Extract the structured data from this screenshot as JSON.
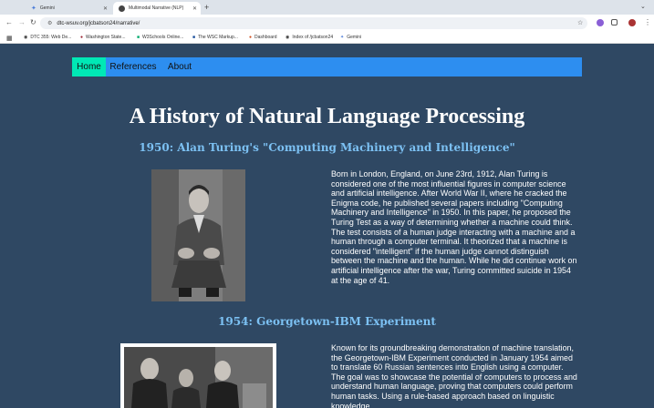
{
  "browser": {
    "tabs": [
      {
        "title": "Gemini"
      },
      {
        "title": "Multimodal Narrative (NLP)"
      }
    ],
    "new_tab": "+",
    "tab_menu": "⌄",
    "url": "dtc-wsuv.org/jcbatson24/narrative/",
    "bookmarks": [
      {
        "label": "DTC 355: Web De..."
      },
      {
        "label": "Washington State..."
      },
      {
        "label": "W3Schools Online..."
      },
      {
        "label": "The WSC Markup..."
      },
      {
        "label": "Dashboard"
      },
      {
        "label": "Index of /jcbatson24"
      },
      {
        "label": "Gemini"
      }
    ]
  },
  "nav": {
    "home": "Home",
    "references": "References",
    "about": "About"
  },
  "page": {
    "title": "A History of Natural Language Processing",
    "sections": [
      {
        "heading": "1950: Alan Turing's \"Computing Machinery and Intelligence\"",
        "text": "Born in London, England, on June 23rd, 1912, Alan Turing is considered one of the most influential figures in computer science and artificial intelligence. After World War II, where he cracked the Enigma code, he published several papers including \"Computing Machinery and Intelligence\" in 1950. In this paper, he proposed the Turing Test as a way of determining whether a machine could think. The test consists of a human judge interacting with a machine and a human through a computer terminal. It theorized that a machine is considered \"intelligent\" if the human judge cannot distinguish between the machine and the human. While he did continue work on artificial intelligence after the war, Turing committed suicide in 1954 at the age of 41."
      },
      {
        "heading": "1954: Georgetown-IBM Experiment",
        "text": "Known for its groundbreaking demonstration of machine translation, the Georgetown-IBM Experiment conducted in January 1954 aimed to translate 60 Russian sentences into English using a computer. The goal was to showcase the potential of computers to process and understand human language, proving that computers could perform human tasks. Using a rule-based approach based on linguistic knowledge"
      }
    ]
  },
  "colors": {
    "background": "#2f4863",
    "navbar": "#2d8ef0",
    "nav_active": "#00e8b5",
    "heading": "#7cc1f3",
    "text": "#ffffff"
  }
}
